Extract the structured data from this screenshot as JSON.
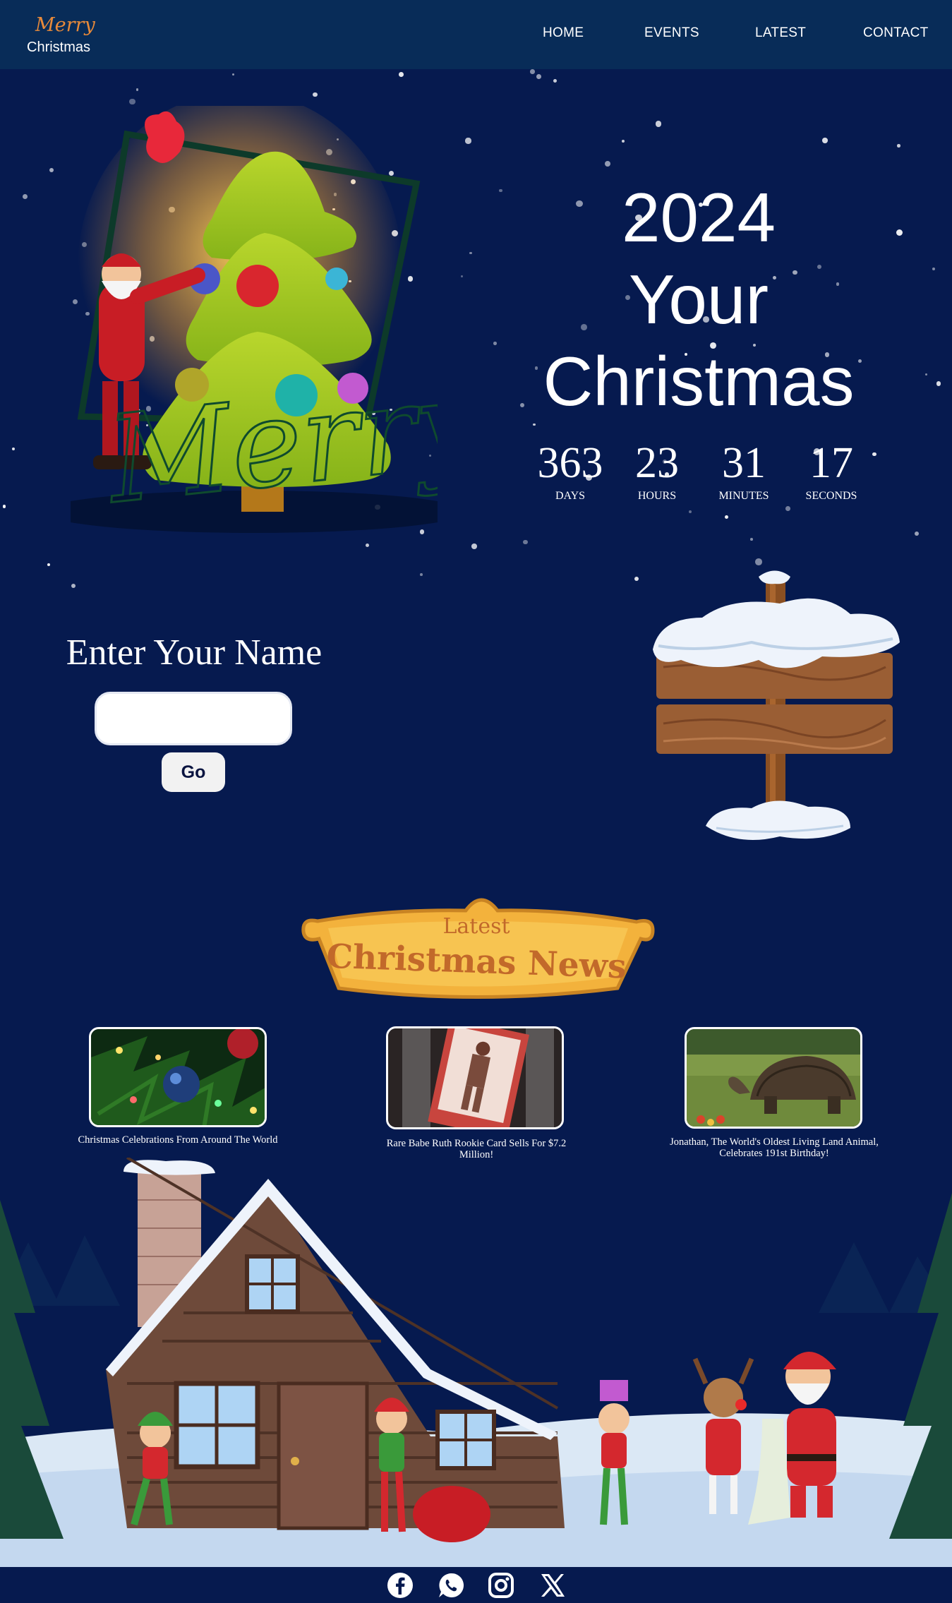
{
  "header": {
    "logo_script": "Merry",
    "logo_text": "Christmas",
    "nav": [
      {
        "label": "HOME",
        "icon": "none"
      },
      {
        "label": "EVENTS",
        "icon": "none"
      },
      {
        "label": "LATEST",
        "icon": "none"
      },
      {
        "label": "CONTACT",
        "icon": "none"
      }
    ]
  },
  "hero": {
    "title_lines": [
      "2024",
      "Your",
      "Christmas"
    ],
    "art_script_text": "Merry",
    "countdown": [
      {
        "value": "363",
        "label": "DAYS"
      },
      {
        "value": "23",
        "label": "HOURS"
      },
      {
        "value": "31",
        "label": "MINUTES"
      },
      {
        "value": "17",
        "label": "SECONDS"
      }
    ]
  },
  "name_form": {
    "title": "Enter Your Name",
    "input_value": "",
    "input_placeholder": "",
    "button_label": "Go"
  },
  "news": {
    "banner_small": "Latest",
    "banner_large": "Christmas News",
    "articles": [
      {
        "title": "Christmas Celebrations From Around The World",
        "thumb": "christmas-ornament-photo"
      },
      {
        "title": "Rare Babe Ruth Rookie Card Sells For $7.2 Million!",
        "thumb": "baseball-card-photo"
      },
      {
        "title": "Jonathan, The World's Oldest Living Land Animal, Celebrates 191st Birthday!",
        "thumb": "giant-tortoise-photo"
      }
    ]
  },
  "footer": {
    "social": [
      "facebook-icon",
      "whatsapp-icon",
      "instagram-icon",
      "x-icon"
    ]
  },
  "colors": {
    "background": "#061a4f",
    "header": "#082c58",
    "logo_accent": "#e88a3a",
    "banner_gold": "#f3b23c",
    "banner_text": "#c2692a"
  }
}
